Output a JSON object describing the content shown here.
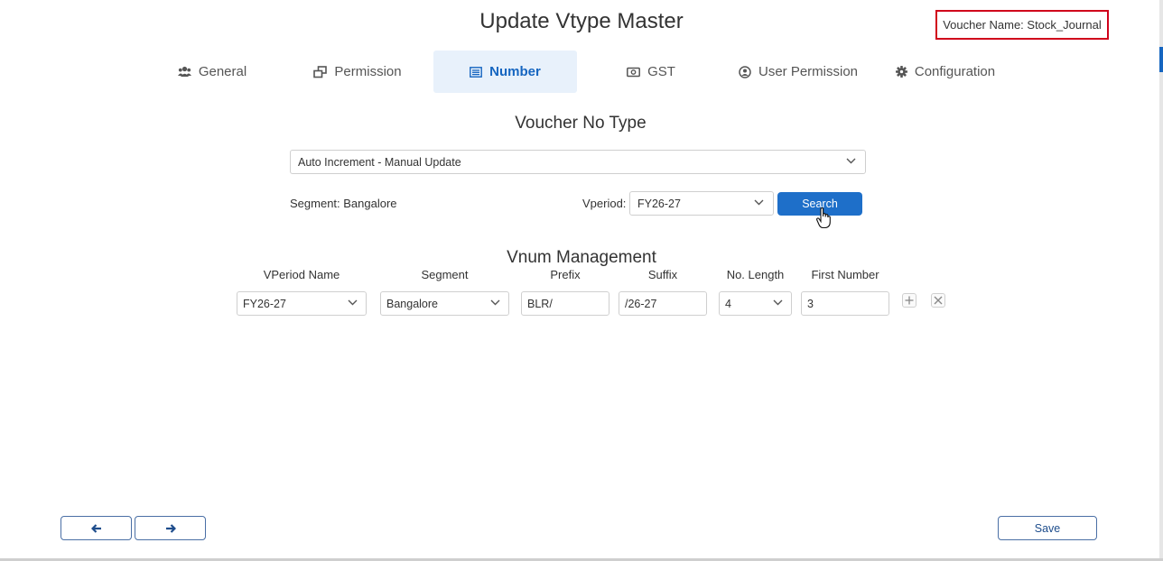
{
  "header": {
    "title": "Update Vtype Master",
    "voucher_name": "Voucher Name: Stock_Journal"
  },
  "tabs": [
    {
      "label": "General",
      "icon": "users-icon",
      "active": false
    },
    {
      "label": "Permission",
      "icon": "copy-icon",
      "active": false
    },
    {
      "label": "Number",
      "icon": "list-icon",
      "active": true
    },
    {
      "label": "GST",
      "icon": "money-icon",
      "active": false
    },
    {
      "label": "User Permission",
      "icon": "user-circle-icon",
      "active": false
    },
    {
      "label": "Configuration",
      "icon": "gear-icon",
      "active": false
    }
  ],
  "voucher_no_type": {
    "heading": "Voucher No Type",
    "selected": "Auto Increment - Manual Update"
  },
  "filter": {
    "segment_label": "Segment: Bangalore",
    "vperiod_label": "Vperiod:",
    "vperiod_value": "FY26-27",
    "search_label": "Search"
  },
  "vnum": {
    "heading": "Vnum Management",
    "columns": [
      "VPeriod Name",
      "Segment",
      "Prefix",
      "Suffix",
      "No. Length",
      "First Number"
    ],
    "row": {
      "vperiod_name": "FY26-27",
      "segment": "Bangalore",
      "prefix": "BLR/",
      "suffix": "/26-27",
      "no_length": "4",
      "first_number": "3"
    }
  },
  "footer": {
    "save_label": "Save"
  },
  "colors": {
    "accent": "#1e6fc9",
    "active_tab_bg": "#e8f1fb",
    "highlight_border": "#d0021b"
  }
}
